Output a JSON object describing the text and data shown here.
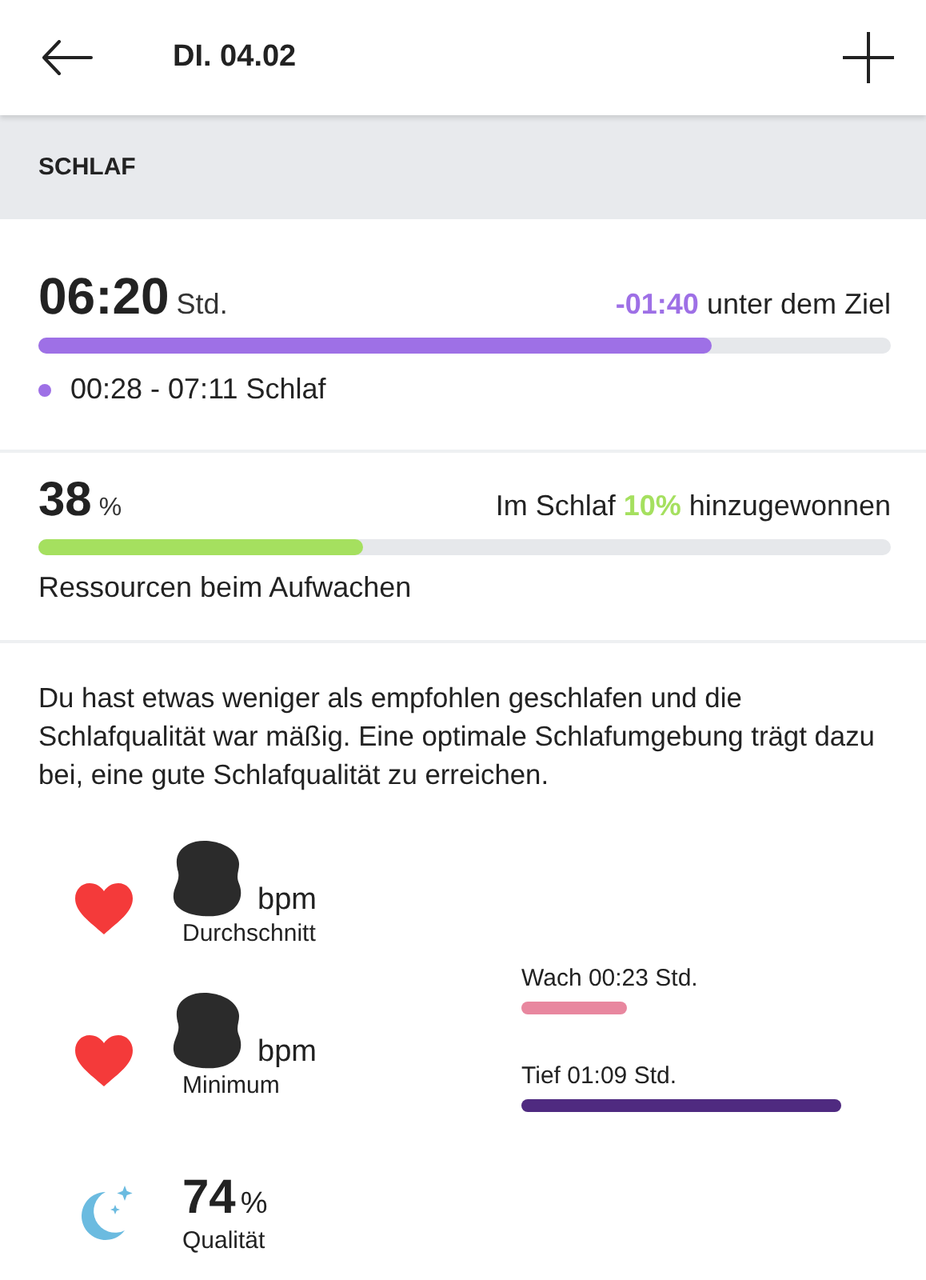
{
  "header": {
    "title": "DI. 04.02"
  },
  "section": {
    "title": "SCHLAF"
  },
  "metrics": [
    {
      "kind": "duration",
      "value": "06:20",
      "unit": "Std.",
      "highlight": "-01:40",
      "note": "unter dem Ziel",
      "level": 0.79,
      "color": "#9e70e6",
      "detail": "00:28 - 07:11 Schlaf"
    },
    {
      "kind": "resources",
      "value": "38",
      "unit": "%",
      "note_prefix": "Im Schlaf",
      "highlight": "10%",
      "note": "hinzugewonnen",
      "level": 0.38,
      "color": "#a5e05f",
      "caption": "Ressourcen beim Aufwachen"
    }
  ],
  "advice": "Du hast etwas weniger als empfohlen geschlafen und die Schlafqualität war mäßig. Eine optimale Schlafumgebung trägt dazu bei, eine gute Schlafqualität zu erreichen.",
  "stats": [
    {
      "kind": "heart",
      "redacted": true,
      "unit": "bpm",
      "label": "Durchschnitt"
    },
    {
      "kind": "heart",
      "redacted": true,
      "unit": "bpm",
      "label": "Minimum"
    },
    {
      "kind": "quality",
      "value": "74",
      "unit": "%",
      "label": "Qualität"
    }
  ],
  "stages": [
    {
      "label": "Wach 00:23 Std.",
      "color": "#e8879f"
    },
    {
      "label": "Tief 01:09 Std.",
      "color": "#4f2a80"
    }
  ]
}
